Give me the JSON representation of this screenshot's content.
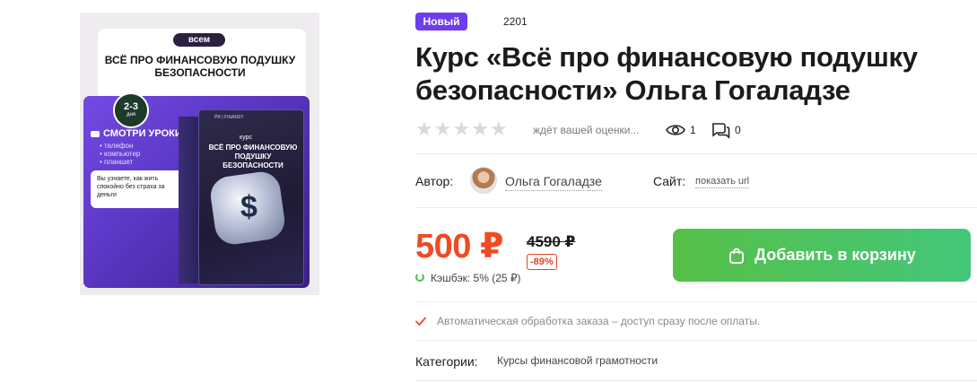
{
  "product": {
    "image": {
      "badge": "всем",
      "title": "Всё про финансовую подушку безопасности",
      "duration_number": "2-3",
      "duration_unit": "дня",
      "watch_label": "СМОТРИ УРОКИ",
      "devices": [
        "телефон",
        "компьютер",
        "планшет"
      ],
      "note": "Вы узнаете, как жить спокойно без страха за деньги",
      "box_brand": "PR | FINANSY",
      "box_label": "курс",
      "box_title": "Всё про финансовую подушку безопасности"
    },
    "badge_new": "Новый",
    "id": "2201",
    "title": "Курс «Всё про финансовую подушку безопасности» Ольга Гогаладзе"
  },
  "rating": {
    "stars_total": 5,
    "stars_filled": 0,
    "text": "ждёт вашей оценки...",
    "views": "1",
    "comments": "0"
  },
  "author": {
    "label": "Автор:",
    "name": "Ольга Гогаладзе",
    "site_label": "Сайт:",
    "site_link": "показать url"
  },
  "price": {
    "current": "500 ₽",
    "old": "4590 ₽",
    "discount": "-89%",
    "cashback": "Кэшбэк: 5% (25 ₽)",
    "cart_button": "Добавить в корзину"
  },
  "info": {
    "auto_processing": "Автоматическая обработка заказа – доступ сразу после оплаты.",
    "categories_label": "Категории:",
    "category": "Курсы финансовой грамотности"
  },
  "colors": {
    "accent_orange": "#f04a23",
    "badge_purple": "#6f3cf0",
    "button_green": "#4fc25a"
  },
  "icons": [
    "eye-icon",
    "comment-icon",
    "shopping-bag-icon",
    "refresh-icon",
    "check-icon",
    "star-icon",
    "dollar-icon",
    "video-icon",
    "plus-icon"
  ]
}
